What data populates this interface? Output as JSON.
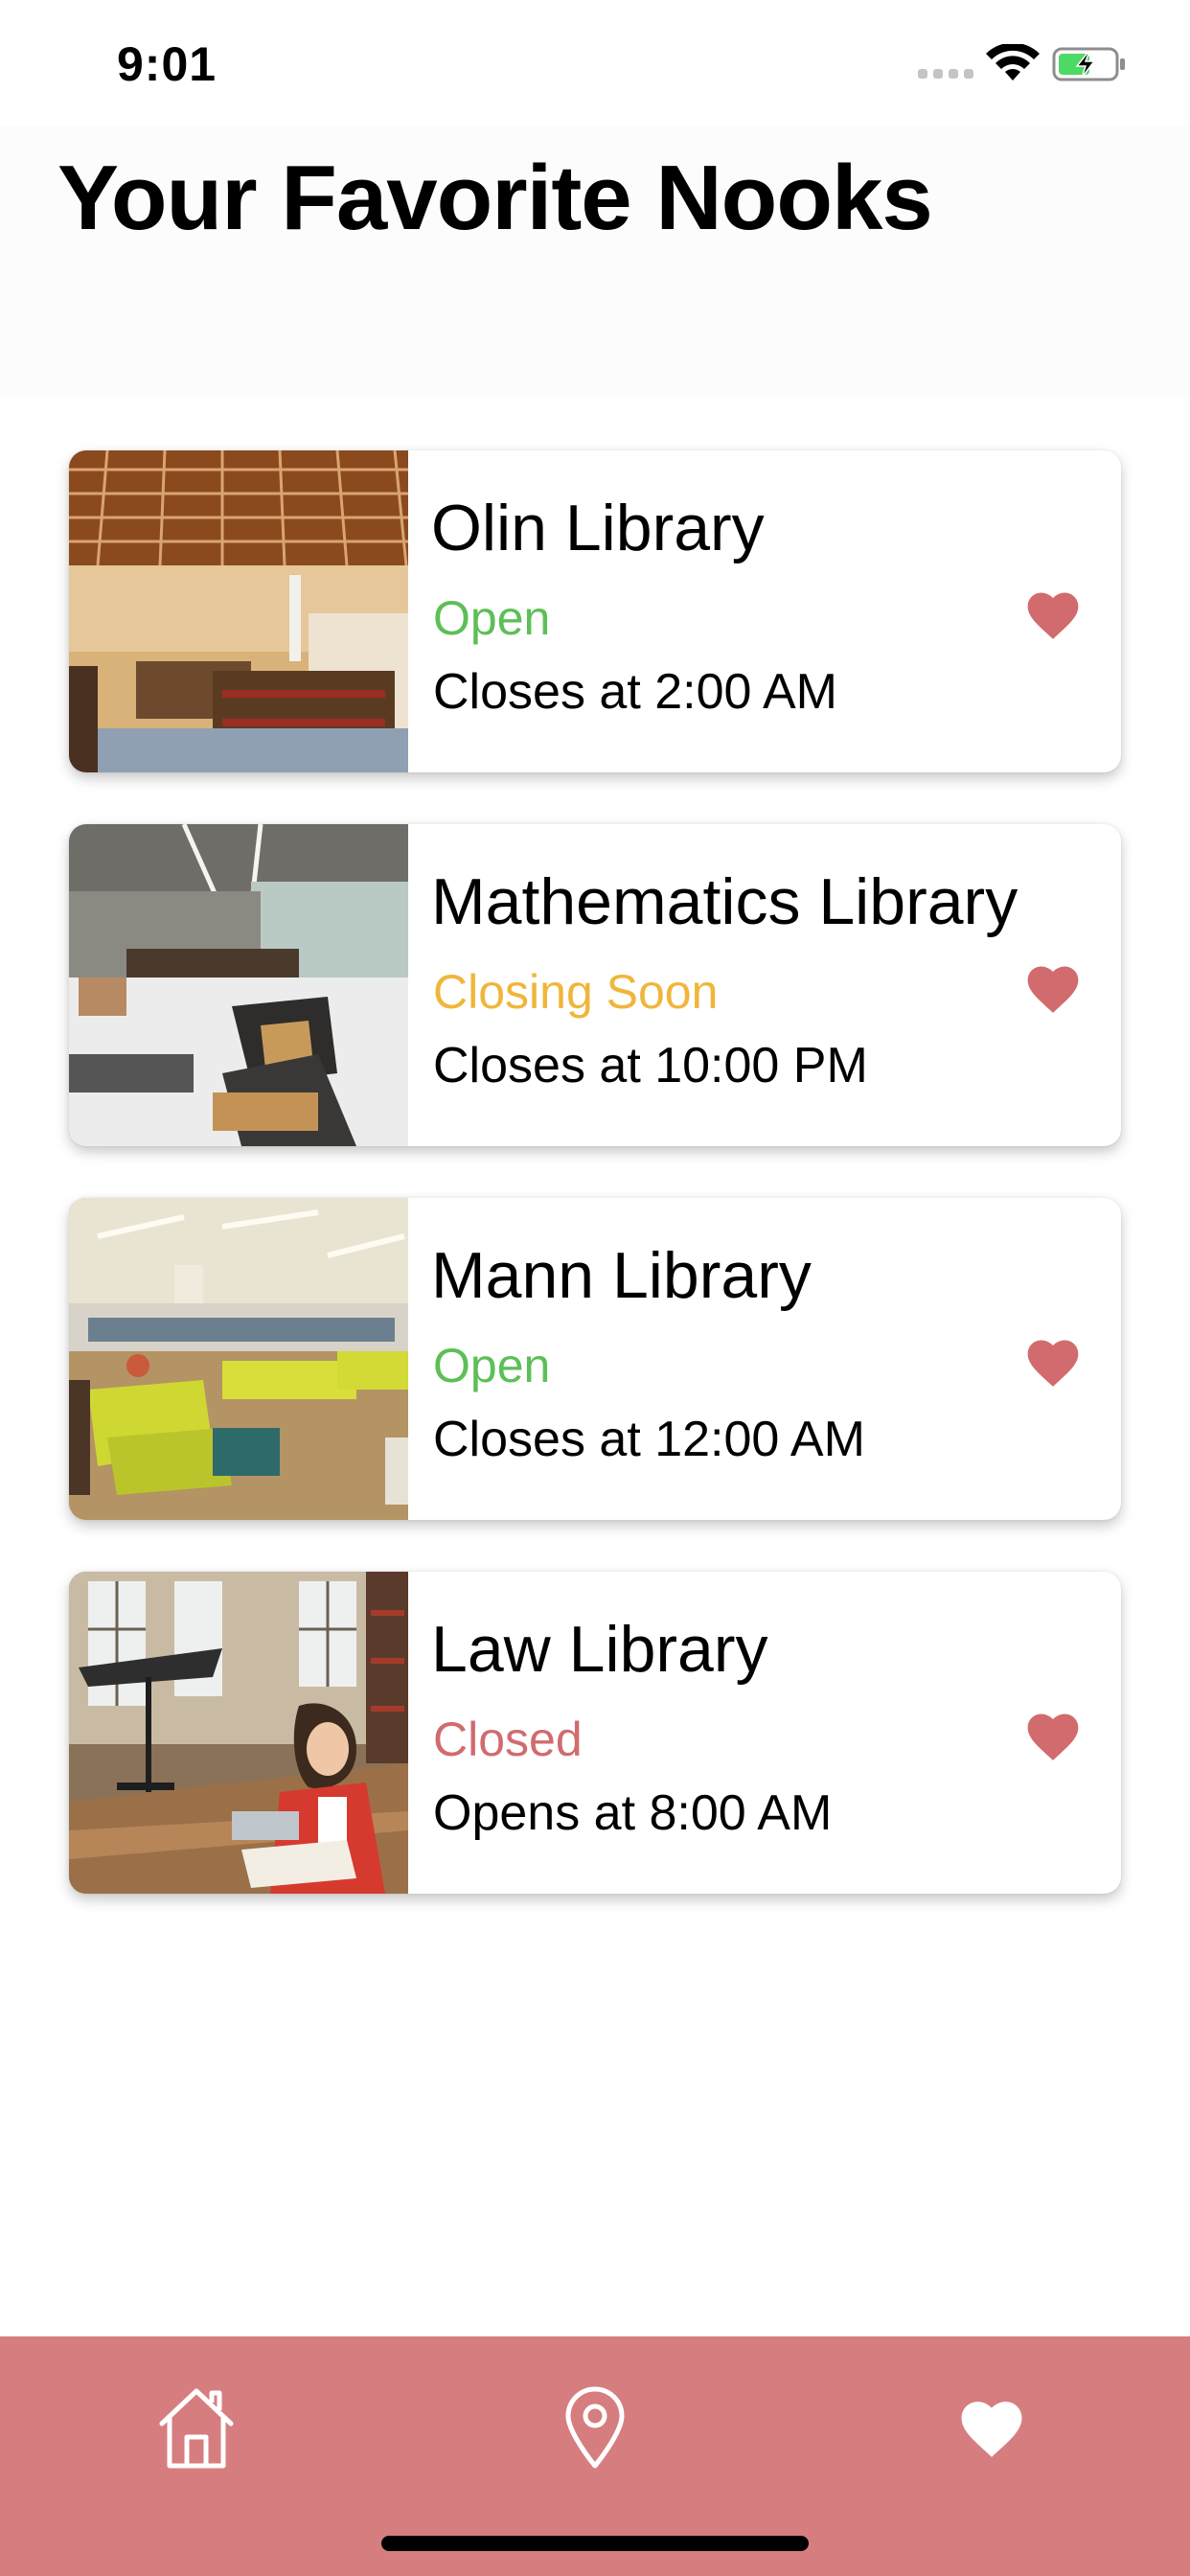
{
  "status_bar": {
    "time": "9:01",
    "icons": [
      "signal-icon",
      "wifi-icon",
      "battery-charging-icon"
    ]
  },
  "header": {
    "title": "Your Favorite Nooks"
  },
  "colors": {
    "open": "#5cbf57",
    "closing_soon": "#f0b63a",
    "closed": "#d16b6e",
    "heart": "#d16b6e",
    "tab_bar": "#d67e7f"
  },
  "libraries": [
    {
      "name": "Olin Library",
      "status": "Open",
      "status_type": "open",
      "hours": "Closes at 2:00 AM",
      "favorited": true
    },
    {
      "name": "Mathematics Library",
      "status": "Closing Soon",
      "status_type": "closing_soon",
      "hours": "Closes at 10:00 PM",
      "favorited": true
    },
    {
      "name": "Mann Library",
      "status": "Open",
      "status_type": "open",
      "hours": "Closes at 12:00 AM",
      "favorited": true
    },
    {
      "name": "Law Library",
      "status": "Closed",
      "status_type": "closed",
      "hours": "Opens at 8:00 AM",
      "favorited": true
    }
  ],
  "tab_bar": {
    "tabs": [
      {
        "icon": "home-icon",
        "selected": false
      },
      {
        "icon": "map-pin-icon",
        "selected": false
      },
      {
        "icon": "heart-icon",
        "selected": true
      }
    ]
  }
}
